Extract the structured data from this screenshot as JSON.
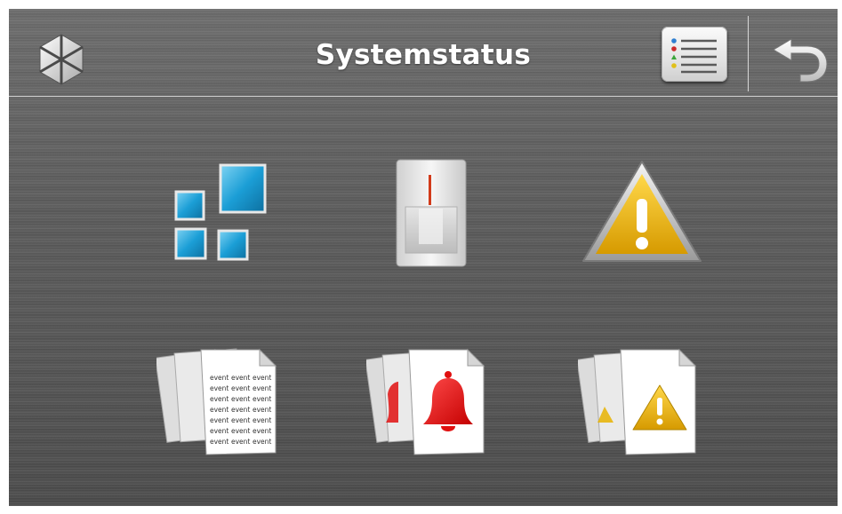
{
  "header": {
    "title": "Systemstatus",
    "logo_icon": "satel-star-logo-icon",
    "menu_icon": "list-menu-icon",
    "back_icon": "back-arrow-icon"
  },
  "tiles": [
    {
      "icon": "partitions-icon"
    },
    {
      "icon": "detector-zones-icon"
    },
    {
      "icon": "warning-triangle-icon"
    },
    {
      "icon": "event-log-icon",
      "doc_text": "event"
    },
    {
      "icon": "alarm-log-icon"
    },
    {
      "icon": "trouble-log-icon"
    }
  ],
  "colors": {
    "background": "#5e5e5e",
    "square_blue": "#1b9ed6",
    "warning_yellow": "#e8b300",
    "alarm_red": "#e01010",
    "title_text": "#ffffff"
  }
}
